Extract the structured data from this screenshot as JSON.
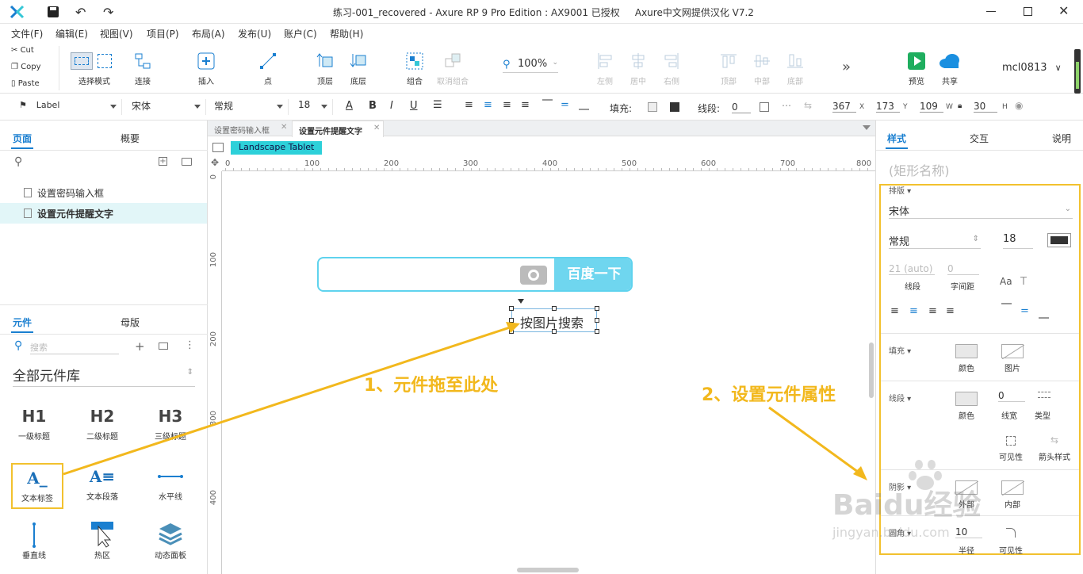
{
  "window": {
    "title": "练习-001_recovered - Axure RP 9 Pro Edition : AX9001 已授权     Axure中文网提供汉化 V7.2"
  },
  "menu": [
    "文件(F)",
    "编辑(E)",
    "视图(V)",
    "项目(P)",
    "布局(A)",
    "发布(U)",
    "账户(C)",
    "帮助(H)"
  ],
  "clipboard": {
    "cut": "Cut",
    "copy": "Copy",
    "paste": "Paste"
  },
  "toolbar": {
    "select_mode": "选择模式",
    "connect": "连接",
    "insert": "插入",
    "point": "点",
    "top": "顶层",
    "bottom": "底层",
    "group": "组合",
    "ungroup": "取消组合",
    "zoom": "100%",
    "align_left": "左侧",
    "align_center": "居中",
    "align_right": "右侧",
    "align_top": "顶部",
    "align_middle": "中部",
    "align_bottom": "底部",
    "preview": "预览",
    "share": "共享",
    "user": "mcl0813"
  },
  "format": {
    "style": "Label",
    "font": "宋体",
    "weight": "常规",
    "size": "18",
    "fill_label": "填充:",
    "line_label": "线段:",
    "line_value": "0",
    "x": "367",
    "x_label": "X",
    "y": "173",
    "y_label": "Y",
    "w": "109",
    "w_label": "W",
    "h": "30",
    "h_label": "H"
  },
  "left": {
    "tab_pages": "页面",
    "tab_outline": "概要",
    "pages": [
      "设置密码输入框",
      "设置元件提醒文字"
    ],
    "tab_widgets": "元件",
    "tab_masters": "母版",
    "search_placeholder": "搜索",
    "library": "全部元件库",
    "widgets": [
      {
        "icon": "H1",
        "label": "一级标题"
      },
      {
        "icon": "H2",
        "label": "二级标题"
      },
      {
        "icon": "H3",
        "label": "三级标题"
      },
      {
        "icon": "A_",
        "label": "文本标签"
      },
      {
        "icon": "A≡",
        "label": "文本段落"
      },
      {
        "icon": "",
        "label": "水平线"
      },
      {
        "icon": "",
        "label": "垂直线"
      },
      {
        "icon": "",
        "label": "热区"
      },
      {
        "icon": "",
        "label": "动态面板"
      }
    ]
  },
  "canvas": {
    "tabs": [
      "设置密码输入框",
      "设置元件提醒文字"
    ],
    "adaptive_view": "Landscape Tablet",
    "ruler_h": [
      "0",
      "100",
      "200",
      "300",
      "400",
      "500",
      "600",
      "700",
      "800"
    ],
    "ruler_v": [
      "0",
      "100",
      "200",
      "300",
      "400"
    ],
    "search_button": "百度一下",
    "label_text": "按图片搜索",
    "annotation1": "1、元件拖至此处",
    "annotation2": "2、设置元件属性"
  },
  "right": {
    "tab_style": "样式",
    "tab_interact": "交互",
    "tab_notes": "说明",
    "shape_name_placeholder": "(矩形名称)",
    "typography_label": "排版",
    "font": "宋体",
    "weight": "常规",
    "size": "18",
    "line_spacing_value": "21 (auto)",
    "line_spacing_label": "线段",
    "char_spacing_value": "0",
    "char_spacing_label": "字间距",
    "fill_label": "填充",
    "color": "颜色",
    "image": "图片",
    "border_label": "线段",
    "border_width_value": "0",
    "border_width_label": "线宽",
    "border_type": "类型",
    "visibility": "可见性",
    "arrow_style": "箭头样式",
    "shadow_label": "阴影",
    "outer": "外部",
    "inner": "内部",
    "radius_label": "圆角",
    "radius_value": "10",
    "radius": "半径"
  },
  "watermark": {
    "brand": "Baidu经验",
    "url": "jingyan.baidu.com"
  },
  "colors": {
    "accent": "#1a7fd0",
    "cyan": "#5fd3ee",
    "annotation": "#f2b81d",
    "adaptive": "#2dd0d9"
  }
}
